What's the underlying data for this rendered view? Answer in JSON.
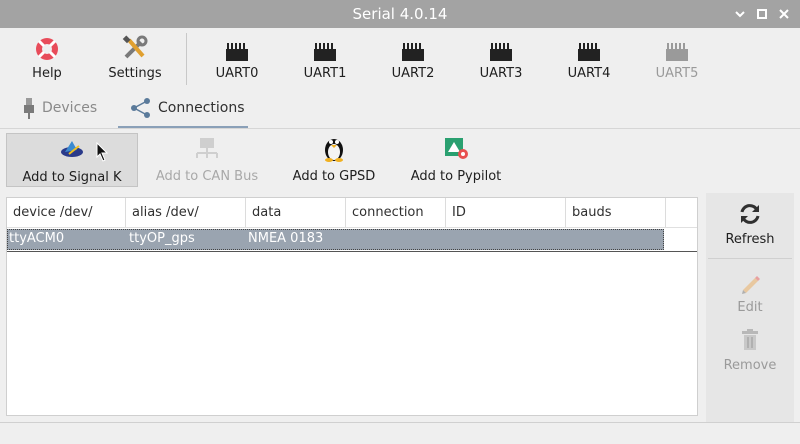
{
  "window": {
    "title": "Serial 4.0.14"
  },
  "toolbar": {
    "help": "Help",
    "settings": "Settings",
    "uarts": [
      "UART0",
      "UART1",
      "UART2",
      "UART3",
      "UART4",
      "UART5"
    ]
  },
  "tabs": {
    "devices": "Devices",
    "connections": "Connections"
  },
  "actions": {
    "signalk": "Add to Signal K",
    "canbus": "Add to CAN Bus",
    "gpsd": "Add to GPSD",
    "pypilot": "Add to Pypilot"
  },
  "table": {
    "headers": [
      "device /dev/",
      "alias /dev/",
      "data",
      "connection",
      "ID",
      "bauds"
    ],
    "rows": [
      {
        "device": "ttyACM0",
        "alias": "ttyOP_gps",
        "data": "NMEA 0183",
        "connection": "",
        "id": "",
        "bauds": ""
      }
    ]
  },
  "side": {
    "refresh": "Refresh",
    "edit": "Edit",
    "remove": "Remove"
  },
  "colors": {
    "titlebar": "#a3a3a3",
    "selection": "#9aa4b0",
    "accent": "#8aa0b8"
  }
}
